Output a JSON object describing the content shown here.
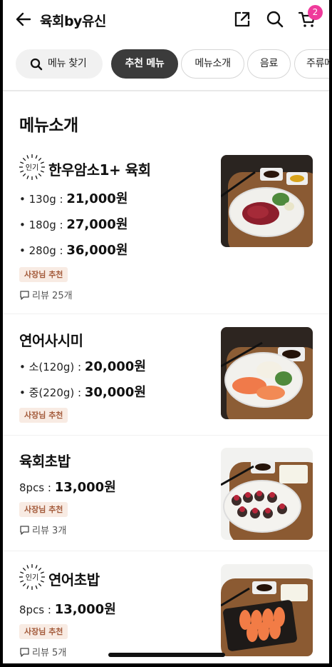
{
  "header": {
    "title": "육회by유신",
    "cart_count": "2"
  },
  "chips": [
    {
      "label": "메뉴 찾기"
    },
    {
      "label": "추천 메뉴"
    },
    {
      "label": "메뉴소개"
    },
    {
      "label": "음료"
    },
    {
      "label": "주류메"
    }
  ],
  "section": {
    "title": "메뉴소개"
  },
  "hot_badge": "인기",
  "items": [
    {
      "name": "한우암소1+ 육회",
      "prices": [
        {
          "label": "• 130g :",
          "price": "21,000원"
        },
        {
          "label": "• 180g :",
          "price": "27,000원"
        },
        {
          "label": "• 280g :",
          "price": "36,000원"
        }
      ],
      "tag": "사장님 추천",
      "review": "리뷰 25개"
    },
    {
      "name": "연어사시미",
      "prices": [
        {
          "label": "• 소(120g) :",
          "price": "20,000원"
        },
        {
          "label": "• 중(220g) :",
          "price": "30,000원"
        }
      ],
      "tag": "사장님 추천"
    },
    {
      "name": "육회초밥",
      "prices": [
        {
          "label": "8pcs :",
          "price": "13,000원"
        }
      ],
      "tag": "사장님 추천",
      "review": "리뷰 3개"
    },
    {
      "name": "연어초밥",
      "prices": [
        {
          "label": "8pcs :",
          "price": "13,000원"
        }
      ],
      "tag": "사장님 추천",
      "review": "리뷰 5개"
    }
  ],
  "icons": [
    "back-arrow-icon",
    "share-icon",
    "search-icon",
    "cart-icon",
    "chat-bubble-icon"
  ],
  "colors": {
    "accent_badge": "#ef3a9b",
    "active_chip": "#3b3b3b",
    "tag_bg": "#f8ebe3",
    "tag_text": "#a35a3a"
  }
}
